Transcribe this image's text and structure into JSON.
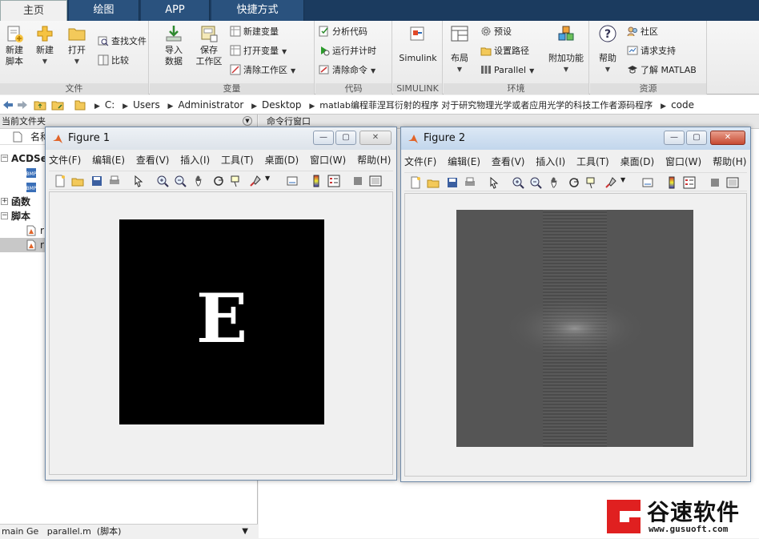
{
  "tabs": [
    {
      "label": "主页",
      "active": true
    },
    {
      "label": "绘图",
      "active": false
    },
    {
      "label": "APP",
      "active": false
    },
    {
      "label": "快捷方式",
      "active": false
    }
  ],
  "ribbon": {
    "file_group": {
      "title": "文件",
      "new_script": "新建\n脚本",
      "new": "新建",
      "open": "打开",
      "find_files": "查找文件",
      "compare": "比较"
    },
    "variable_group": {
      "title": "变量",
      "import_data": "导入\n数据",
      "save_workspace": "保存\n工作区",
      "new_variable": "新建变量",
      "open_variable": "打开变量",
      "clear_workspace": "清除工作区"
    },
    "code_group": {
      "title": "代码",
      "analyze_code": "分析代码",
      "run_and_time": "运行并计时",
      "clear_commands": "清除命令"
    },
    "simulink_group": {
      "title": "SIMULINK",
      "simulink": "Simulink"
    },
    "environment_group": {
      "title": "环境",
      "layout": "布局",
      "preferences": "预设",
      "set_path": "设置路径",
      "parallel": "Parallel",
      "addons": "附加功能"
    },
    "resources_group": {
      "title": "资源",
      "help": "帮助",
      "community": "社区",
      "request_support": "请求支持",
      "learn_matlab": "了解 MATLAB"
    }
  },
  "address": {
    "crumbs": [
      "C:",
      "Users",
      "Administrator",
      "Desktop",
      "matlab编程菲涅耳衍射的程序 对于研究物理光学或者应用光学的科技工作者源码程序",
      "code"
    ]
  },
  "current_folder": {
    "title": "当前文件夹",
    "column_name": "名称",
    "rows": [
      {
        "label": "ACDSe",
        "type": "folder-open",
        "bold": true
      },
      {
        "label": "",
        "type": "bmp"
      },
      {
        "label": "",
        "type": "bmp"
      },
      {
        "label": "函数",
        "type": "group"
      },
      {
        "label": "脚本",
        "type": "group"
      },
      {
        "label": "r",
        "type": "script"
      },
      {
        "label": "r",
        "type": "script",
        "selected": true
      }
    ],
    "status": "main Ge   parallel.m  (脚本)"
  },
  "command_window": {
    "title": "命令行窗口"
  },
  "figure1": {
    "title": "Figure 1",
    "letter": "E",
    "menu": [
      "文件(F)",
      "编辑(E)",
      "查看(V)",
      "插入(I)",
      "工具(T)",
      "桌面(D)",
      "窗口(W)",
      "帮助(H)"
    ]
  },
  "figure2": {
    "title": "Figure 2",
    "menu": [
      "文件(F)",
      "编辑(E)",
      "查看(V)",
      "插入(I)",
      "工具(T)",
      "桌面(D)",
      "窗口(W)",
      "帮助(H)"
    ]
  },
  "watermark": {
    "brand": "谷速软件",
    "url": "www.gusuoft.com"
  }
}
